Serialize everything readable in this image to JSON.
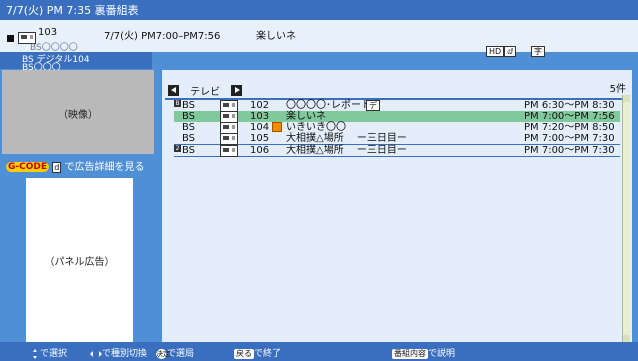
{
  "header": {
    "title": "7/7(火) PM  7:35 裏番組表"
  },
  "current": {
    "channel": "103",
    "network": "BS〇〇〇〇",
    "time": "7/7(火) PM7:00–PM7:56",
    "program": "楽しいネ",
    "tags": [
      "HD",
      "字"
    ]
  },
  "bsbar": {
    "line1": "BS   デジタル104",
    "line2": "BS〇〇〇"
  },
  "left": {
    "video_label": "（映像）",
    "gcode_logo": "G-CODE",
    "gcode_key": "d",
    "gcode_text": "で広告詳細を見る",
    "panel_label": "（パネル広告）"
  },
  "list": {
    "nav_label": "テレビ",
    "count": "5件",
    "rows": [
      {
        "mark": "B",
        "net": "BS",
        "ch": "102",
        "title": "〇〇〇〇･レポート",
        "badges": [
          "映",
          "デ"
        ],
        "time": "PM  6:30〜PM  8:30",
        "selected": false
      },
      {
        "mark": "",
        "net": "BS",
        "ch": "103",
        "title": "楽しいネ",
        "badges": [],
        "time": "PM  7:00〜PM  7:56",
        "selected": true
      },
      {
        "mark": "",
        "net": "BS",
        "ch": "104",
        "title": "いきいき〇〇",
        "badges": [],
        "time": "PM  7:20〜PM  8:50",
        "selected": false,
        "orange": true
      },
      {
        "mark": "",
        "net": "BS",
        "ch": "105",
        "title": "大相撲△場所 　ー三日目ー",
        "badges": [],
        "time": "PM  7:00〜PM  7:30",
        "selected": false
      },
      {
        "mark": "2",
        "net": "BS",
        "ch": "106",
        "title": "大相撲△場所 　ー三日目ー",
        "badges": [],
        "time": "PM  7:00〜PM  7:30",
        "selected": false
      }
    ]
  },
  "footer": {
    "select": "で選択",
    "switch": "で種別切換",
    "enter_key": "決定",
    "enter": "で選局",
    "back_key": "戻る",
    "back": "で終了",
    "info_key": "番組内容",
    "info": "で説明"
  }
}
